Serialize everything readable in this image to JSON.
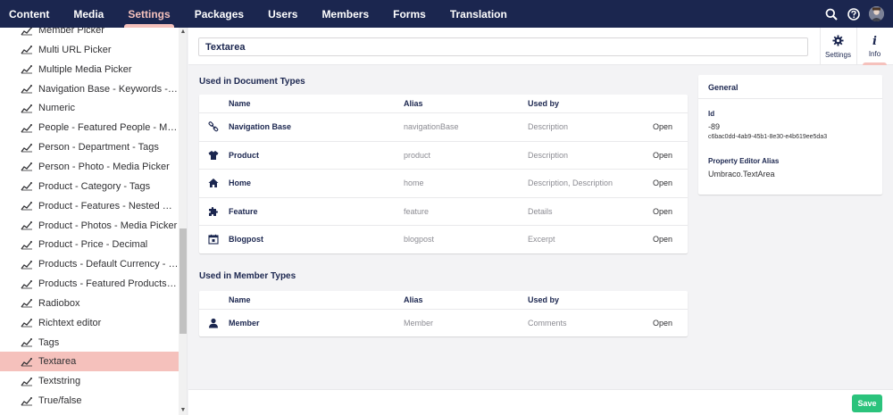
{
  "topnav": {
    "items": [
      "Content",
      "Media",
      "Settings",
      "Packages",
      "Users",
      "Members",
      "Forms",
      "Translation"
    ],
    "active": "Settings"
  },
  "topicons": [
    "search-icon",
    "help-icon",
    "avatar"
  ],
  "sidebar": {
    "items": [
      {
        "label": "Member Picker"
      },
      {
        "label": "Multi URL Picker"
      },
      {
        "label": "Multiple Media Picker"
      },
      {
        "label": "Navigation Base - Keywords - Tags"
      },
      {
        "label": "Numeric"
      },
      {
        "label": "People - Featured People - Multinode Treepicker"
      },
      {
        "label": "Person - Department - Tags"
      },
      {
        "label": "Person - Photo - Media Picker"
      },
      {
        "label": "Product - Category - Tags"
      },
      {
        "label": "Product - Features - Nested Content"
      },
      {
        "label": "Product - Photos - Media Picker"
      },
      {
        "label": "Product - Price - Decimal"
      },
      {
        "label": "Products - Default Currency - Dropdown"
      },
      {
        "label": "Products - Featured Products - Multinode Treepicker"
      },
      {
        "label": "Radiobox"
      },
      {
        "label": "Richtext editor"
      },
      {
        "label": "Tags"
      },
      {
        "label": "Textarea",
        "active": true
      },
      {
        "label": "Textstring"
      },
      {
        "label": "True/false"
      }
    ]
  },
  "header": {
    "name_value": "Textarea",
    "apps": [
      {
        "label": "Settings",
        "icon": "gear-icon"
      },
      {
        "label": "Info",
        "icon": "info-icon",
        "active": true
      }
    ]
  },
  "doc_types": {
    "title": "Used in Document Types",
    "columns": {
      "name": "Name",
      "alias": "Alias",
      "used_by": "Used by"
    },
    "rows": [
      {
        "icon": "link-icon",
        "name": "Navigation Base",
        "alias": "navigationBase",
        "used_by": "Description",
        "open": "Open"
      },
      {
        "icon": "shirt-icon",
        "name": "Product",
        "alias": "product",
        "used_by": "Description",
        "open": "Open"
      },
      {
        "icon": "home-icon",
        "name": "Home",
        "alias": "home",
        "used_by": "Description, Description",
        "open": "Open"
      },
      {
        "icon": "puzzle-icon",
        "name": "Feature",
        "alias": "feature",
        "used_by": "Details",
        "open": "Open"
      },
      {
        "icon": "calendar-icon",
        "name": "Blogpost",
        "alias": "blogpost",
        "used_by": "Excerpt",
        "open": "Open"
      }
    ]
  },
  "member_types": {
    "title": "Used in Member Types",
    "columns": {
      "name": "Name",
      "alias": "Alias",
      "used_by": "Used by"
    },
    "rows": [
      {
        "icon": "user-icon",
        "name": "Member",
        "alias": "Member",
        "used_by": "Comments",
        "open": "Open"
      }
    ]
  },
  "general": {
    "title": "General",
    "id_label": "Id",
    "id_value": "-89",
    "guid": "c6bac0dd-4ab9-45b1-8e30-e4b619ee5da3",
    "alias_label": "Property Editor Alias",
    "alias_value": "Umbraco.TextArea"
  },
  "footer": {
    "save_label": "Save"
  },
  "colors": {
    "topbar": "#1b264f",
    "accent": "#f5c1bc",
    "save": "#2bc37c"
  }
}
